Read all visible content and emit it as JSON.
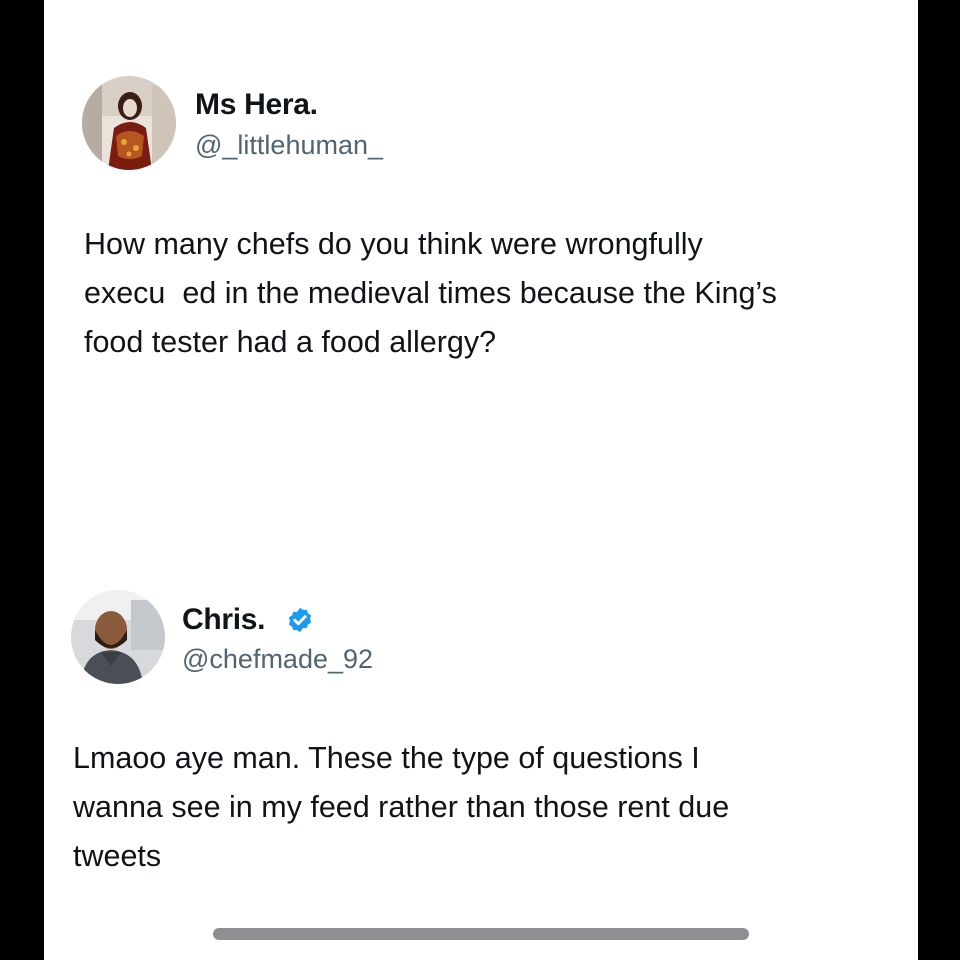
{
  "tweets": [
    {
      "display_name": "Ms Hera.",
      "handle": "@_littlehuman_",
      "verified": false,
      "text": "How many chefs do you think were wrongfully\nexecu  ed in the medieval times because the King’s\nfood tester had a food allergy?"
    },
    {
      "display_name": "Chris.",
      "handle": "@chefmade_92",
      "verified": true,
      "text": "Lmaoo aye man. These the type of questions I\nwanna see in my feed rather than those rent due\ntweets"
    }
  ],
  "icons": {
    "verified": "verified-badge-icon"
  },
  "colors": {
    "background": "#ffffff",
    "frame": "#000000",
    "name_text": "#0f1419",
    "handle_text": "#536471",
    "verified_blue": "#1d9bf0",
    "home_indicator": "#8e8e93"
  }
}
